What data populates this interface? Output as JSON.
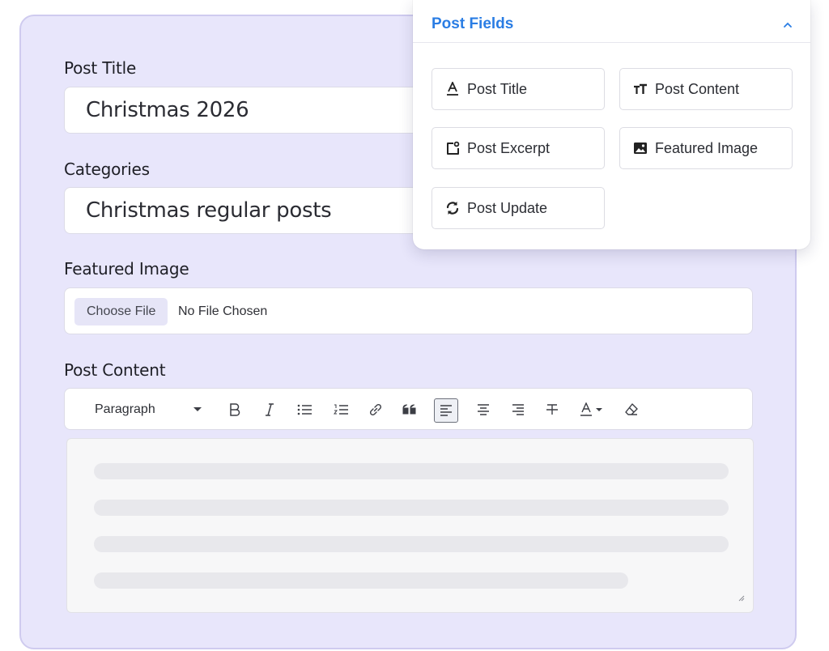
{
  "form": {
    "post_title_label": "Post Title",
    "post_title_value": "Christmas 2026",
    "categories_label": "Categories",
    "categories_value": "Christmas regular posts",
    "featured_image_label": "Featured Image",
    "choose_file_label": "Choose File",
    "no_file_text": "No File Chosen",
    "post_content_label": "Post Content"
  },
  "toolbar": {
    "paragraph_label": "Paragraph",
    "icons": [
      "chevron-down-icon",
      "bold-icon",
      "italic-icon",
      "bulleted-list-icon",
      "numbered-list-icon",
      "link-icon",
      "blockquote-icon",
      "align-left-icon",
      "align-center-icon",
      "align-right-icon",
      "strikethrough-icon",
      "text-color-icon",
      "clear-format-icon"
    ],
    "active": "align-left-icon"
  },
  "panel": {
    "title": "Post Fields",
    "buttons": [
      {
        "label": "Post Title",
        "icon": "text-underline-icon"
      },
      {
        "label": "Post Content",
        "icon": "text-size-icon"
      },
      {
        "label": "Post Excerpt",
        "icon": "excerpt-icon"
      },
      {
        "label": "Featured Image",
        "icon": "image-icon"
      },
      {
        "label": "Post Update",
        "icon": "sync-icon"
      }
    ]
  },
  "colors": {
    "card_bg": "#e8e6fb",
    "accent": "#2a7de4"
  }
}
